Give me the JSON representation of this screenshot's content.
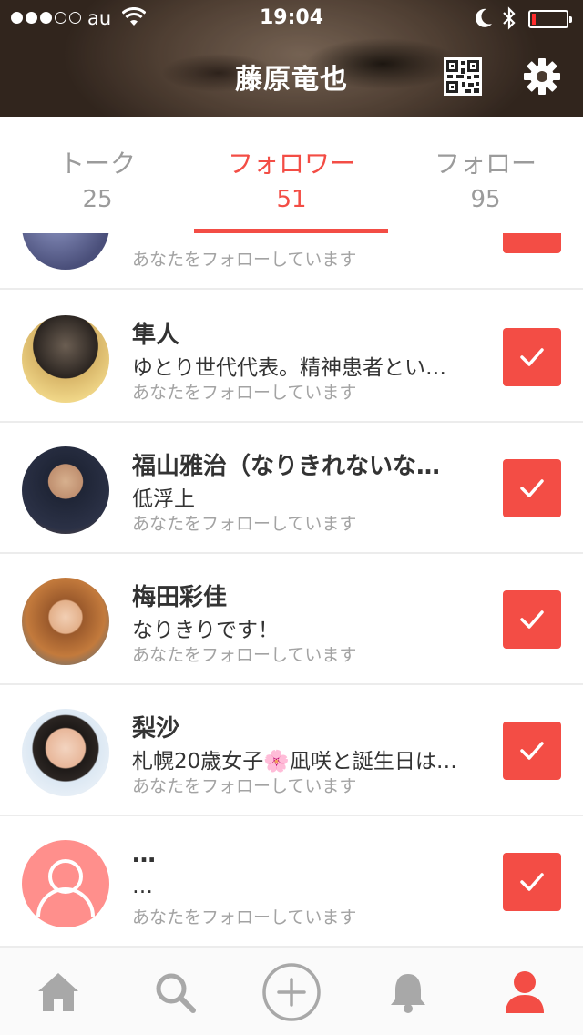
{
  "status_bar": {
    "carrier": "au",
    "time": "19:04",
    "signal_filled": 3,
    "signal_total": 5,
    "battery_level": 0.08
  },
  "header": {
    "title": "藤原竜也",
    "icons": [
      "qr-code-icon",
      "gear-icon"
    ]
  },
  "tabs": [
    {
      "label": "トーク",
      "count": "25",
      "active": false
    },
    {
      "label": "フォロワー",
      "count": "51",
      "active": true
    },
    {
      "label": "フォロー",
      "count": "95",
      "active": false
    }
  ],
  "followers": [
    {
      "name": "",
      "bio": "",
      "status": "あなたをフォローしています"
    },
    {
      "name": "隼人",
      "bio": "ゆとり世代代表。精神患者とい…",
      "status": "あなたをフォローしています"
    },
    {
      "name": "福山雅治（なりきれないな…",
      "bio": "低浮上",
      "status": "あなたをフォローしています"
    },
    {
      "name": "梅田彩佳",
      "bio": "なりきりです！",
      "status": "あなたをフォローしています"
    },
    {
      "name": "梨沙",
      "bio": "札幌20歳女子🌸凪咲と誕生日は…",
      "status": "あなたをフォローしています"
    },
    {
      "name": "…",
      "bio": "…",
      "status": "あなたをフォローしています"
    }
  ],
  "bottom_nav": [
    "home-icon",
    "search-icon",
    "add-icon",
    "bell-icon",
    "user-icon"
  ],
  "colors": {
    "accent": "#f34d45",
    "default_avatar": "#ff8f8c",
    "muted_text": "#a3a3a3",
    "nav_icon": "#a8a8a8"
  }
}
